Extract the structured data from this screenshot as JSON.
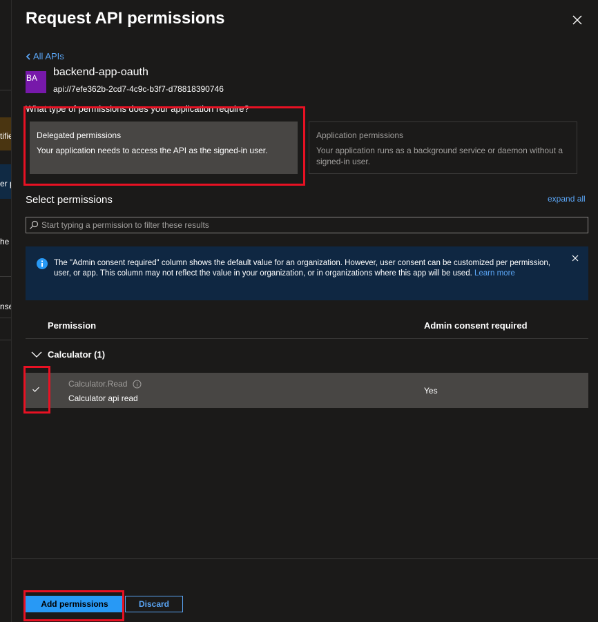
{
  "background": {
    "fragments": [
      "tifie",
      "er p",
      "he",
      "nse"
    ]
  },
  "panel": {
    "title": "Request API permissions",
    "back_link": "All APIs",
    "app": {
      "avatar_initials": "BA",
      "avatar_color": "#7719aa",
      "name": "backend-app-oauth",
      "api_id": "api://7efe362b-2cd7-4c9c-b3f7-d78818390746"
    },
    "question": "What type of permissions does your application require?",
    "options": [
      {
        "title": "Delegated permissions",
        "desc": "Your application needs to access the API as the signed-in user.",
        "selected": true
      },
      {
        "title": "Application permissions",
        "desc": "Your application runs as a background service or daemon without a signed-in user.",
        "selected": false
      }
    ],
    "select_permissions_label": "Select permissions",
    "expand_all": "expand all",
    "search_placeholder": "Start typing a permission to filter these results",
    "info_banner": {
      "text": "The \"Admin consent required\" column shows the default value for an organization. However, user consent can be customized per permission, user, or app. This column may not reflect the value in your organization, or in organizations where this app will be used.",
      "link": "Learn more"
    },
    "table": {
      "columns": [
        "Permission",
        "Admin consent required"
      ],
      "group": {
        "label": "Calculator (1)"
      },
      "rows": [
        {
          "name": "Calculator.Read",
          "description": "Calculator api read",
          "admin_consent": "Yes",
          "checked": true
        }
      ]
    },
    "buttons": {
      "add": "Add permissions",
      "discard": "Discard"
    }
  },
  "colors": {
    "accent": "#2899f5",
    "link": "#5aa5f5",
    "highlight": "#e81123",
    "info_bg": "#0f2742"
  }
}
